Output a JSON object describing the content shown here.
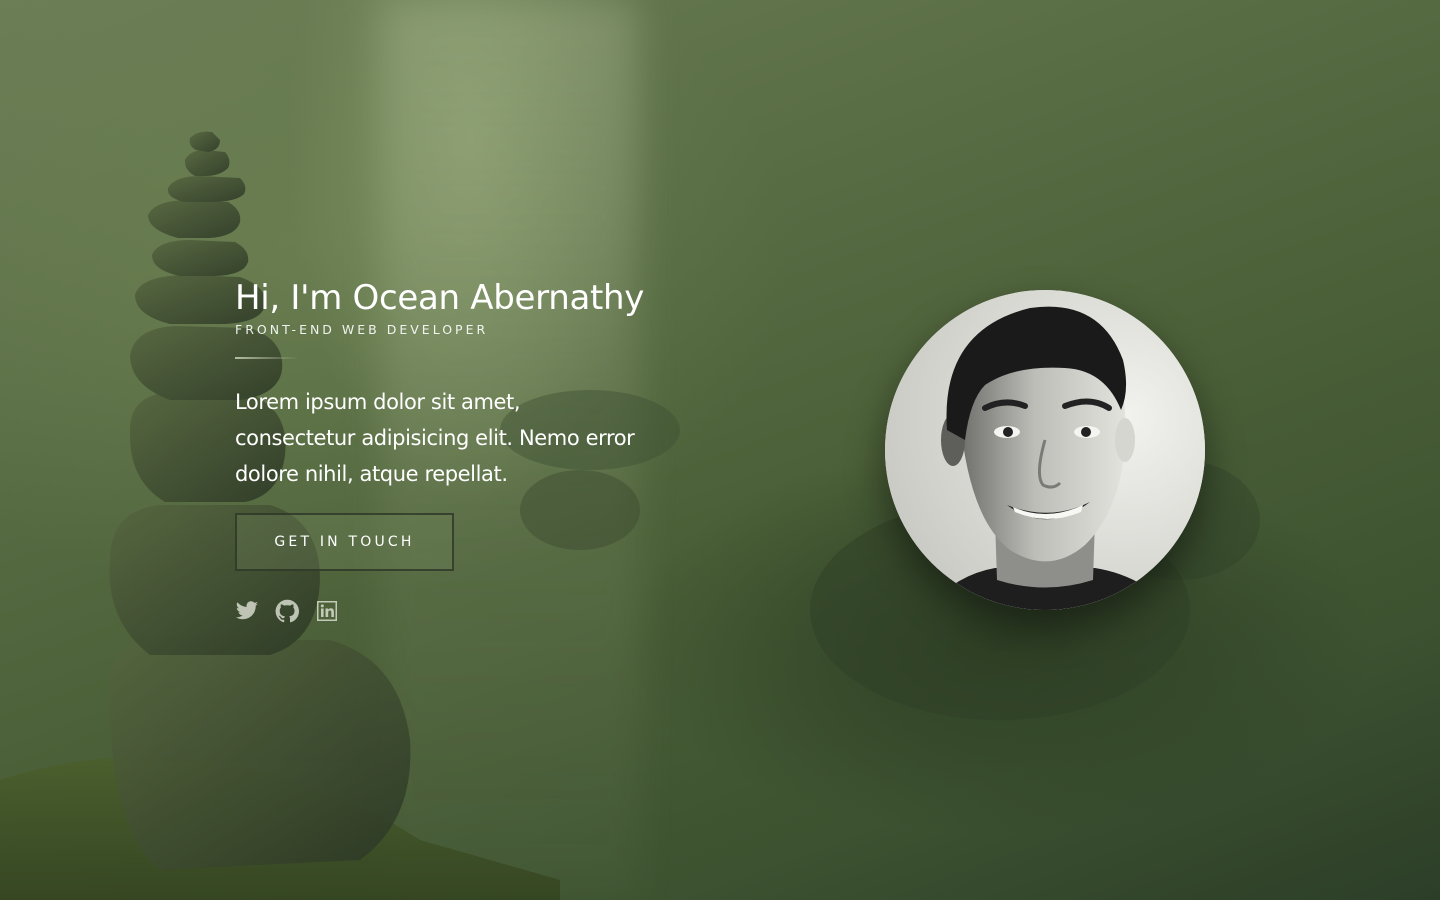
{
  "hero": {
    "title": "Hi, I'm Ocean Abernathy",
    "subtitle": "FRONT-END WEB DEVELOPER",
    "description": "Lorem ipsum dolor sit amet, consectetur adipisicing elit. Nemo error dolore nihil, atque repellat.",
    "cta_label": "GET IN TOUCH"
  },
  "social": [
    {
      "icon": "twitter-icon"
    },
    {
      "icon": "github-icon"
    },
    {
      "icon": "linkedin-icon"
    }
  ],
  "avatar": {
    "icon": "profile-photo"
  },
  "colors": {
    "background_dark": "#2c3e28",
    "background_light": "#6b7d55",
    "text": "#ffffff"
  }
}
